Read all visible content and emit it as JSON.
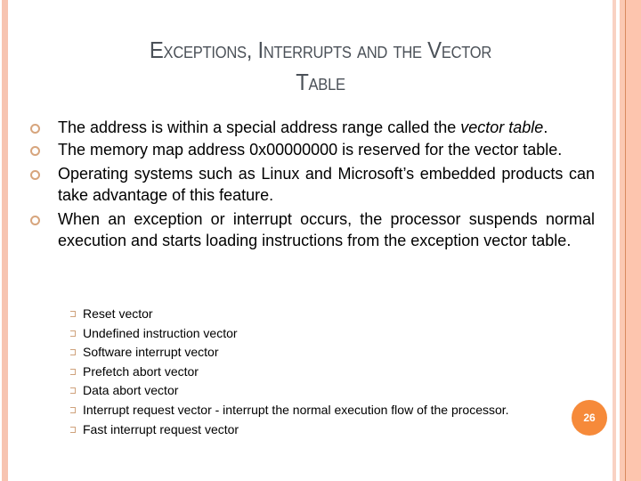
{
  "slide": {
    "title_line1": "Exceptions, Interrupts and the Vector",
    "title_line2": "Table",
    "page_number": "26",
    "accent_color": "#f68a3a",
    "border_color": "#f7c4b1"
  },
  "bullets": [
    {
      "before": "The address is within a special address range called the ",
      "em": "vector table",
      "after": "."
    },
    {
      "text": "The memory map address 0x00000000 is reserved for the vector table."
    },
    {
      "text": "Operating systems such as Linux and Microsoft’s embedded products can take advantage of this feature."
    },
    {
      "text": "When an exception or interrupt occurs, the processor suspends normal execution and starts loading instructions from the exception vector table."
    }
  ],
  "sub_bullets": [
    "Reset vector",
    "Undefined instruction vector",
    "Software interrupt vector",
    "Prefetch abort vector",
    "Data abort vector",
    "Interrupt request vector - interrupt the normal execution flow of the processor.",
    "Fast interrupt request vector"
  ],
  "icons": {
    "main_bullet": "hollow-circle-bullet-icon",
    "sub_bullet": "box-bullet-icon"
  }
}
